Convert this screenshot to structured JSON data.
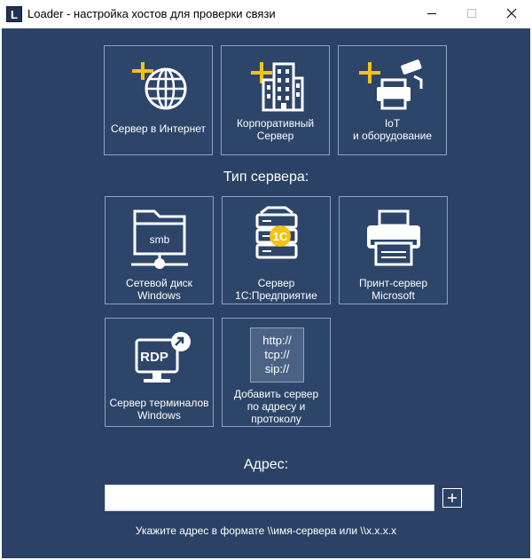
{
  "window": {
    "title": "Loader - настройка хостов для проверки связи",
    "app_icon_letter": "L"
  },
  "top_tiles": [
    {
      "label": "Сервер в Интернет",
      "icon": "globe-add-icon"
    },
    {
      "label": "Корпоративный\nСервер",
      "icon": "building-add-icon"
    },
    {
      "label": "IoT\nи оборудование",
      "icon": "camera-printer-add-icon"
    }
  ],
  "server_type_title": "Тип сервера:",
  "server_tiles": [
    {
      "label": "Сетевой диск\nWindows",
      "icon": "folder-smb-icon",
      "icon_text": "smb"
    },
    {
      "label": "Сервер\n1С:Предприятие",
      "icon": "server-1c-icon",
      "icon_text": "1С"
    },
    {
      "label": "Принт-сервер\nMicrosoft",
      "icon": "printer-icon"
    },
    {
      "label": "Сервер терминалов\nWindows",
      "icon": "rdp-monitor-icon",
      "icon_text": "RDP"
    },
    {
      "label": "Добавить сервер\nпо адресу и\nпротоколу",
      "icon": "protocol-icon",
      "icon_lines": [
        "http://",
        "tcp://",
        "sip://"
      ]
    }
  ],
  "address": {
    "label": "Адрес:",
    "value": "",
    "placeholder": "",
    "hint": "Укажите адрес в формате \\\\имя-сервера или \\\\x.x.x.x",
    "add_button": "+"
  },
  "colors": {
    "background": "#2b4266",
    "tile_border": "#8fa3c2",
    "accent_plus": "#f3c316",
    "icon_white": "#ffffff"
  }
}
